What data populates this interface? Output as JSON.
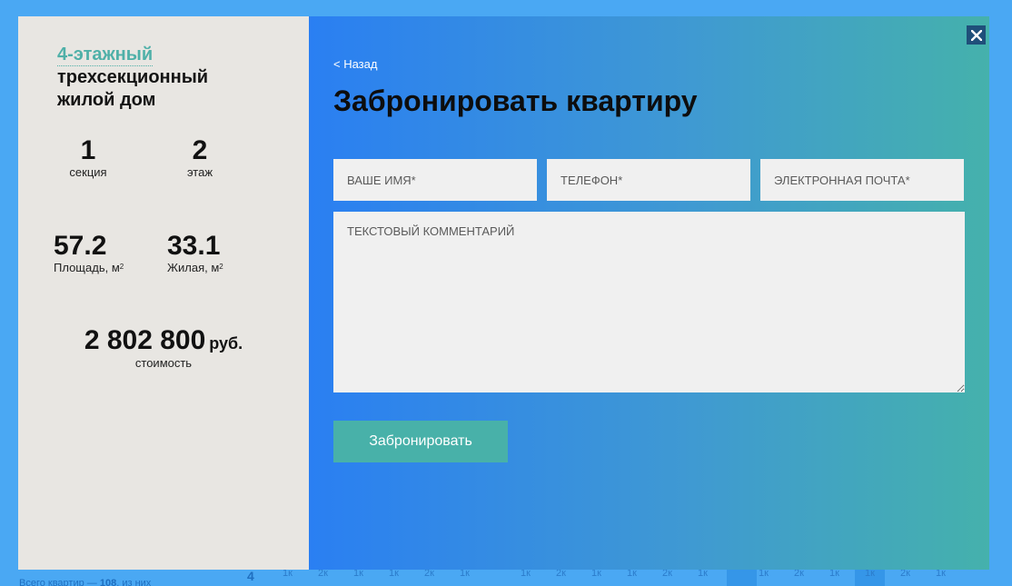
{
  "background": {
    "total_label": "Всего квартир —",
    "total_count": "108",
    "total_suffix": "из них",
    "section_number": "4",
    "cells": [
      "1к",
      "2к",
      "1к",
      "1к",
      "2к",
      "1к",
      "",
      "1к",
      "2к",
      "1к",
      "1к",
      "2к",
      "1к",
      "",
      "1к",
      "2к",
      "1к",
      "1к",
      "2к",
      "1к"
    ]
  },
  "house": {
    "floors_link": "4-этажный",
    "description": "трехсекционный жилой дом"
  },
  "stats": {
    "section_value": "1",
    "section_label": "секция",
    "floor_value": "2",
    "floor_label": "этаж",
    "area_value": "57.2",
    "area_label": "Площадь, м",
    "area_sup": "2",
    "living_value": "33.1",
    "living_label": "Жилая, м",
    "living_sup": "2",
    "price_value": "2 802 800",
    "price_unit": "руб.",
    "price_label": "стоимость"
  },
  "form": {
    "back_label": "< Назад",
    "title": "Забронировать квартиру",
    "name_placeholder": "ВАШЕ ИМЯ*",
    "phone_placeholder": "ТЕЛЕФОН*",
    "email_placeholder": "ЭЛЕКТРОННАЯ ПОЧТА*",
    "comment_placeholder": "ТЕКСТОВЫЙ КОММЕНТАРИЙ",
    "submit_label": "Забронировать"
  },
  "colors": {
    "accent": "#48b1a9",
    "left_panel_bg": "#e8e6e2",
    "gradient_start": "#2a7ff2",
    "gradient_end": "#45b1ac",
    "page_bg": "#4aa8f3"
  }
}
